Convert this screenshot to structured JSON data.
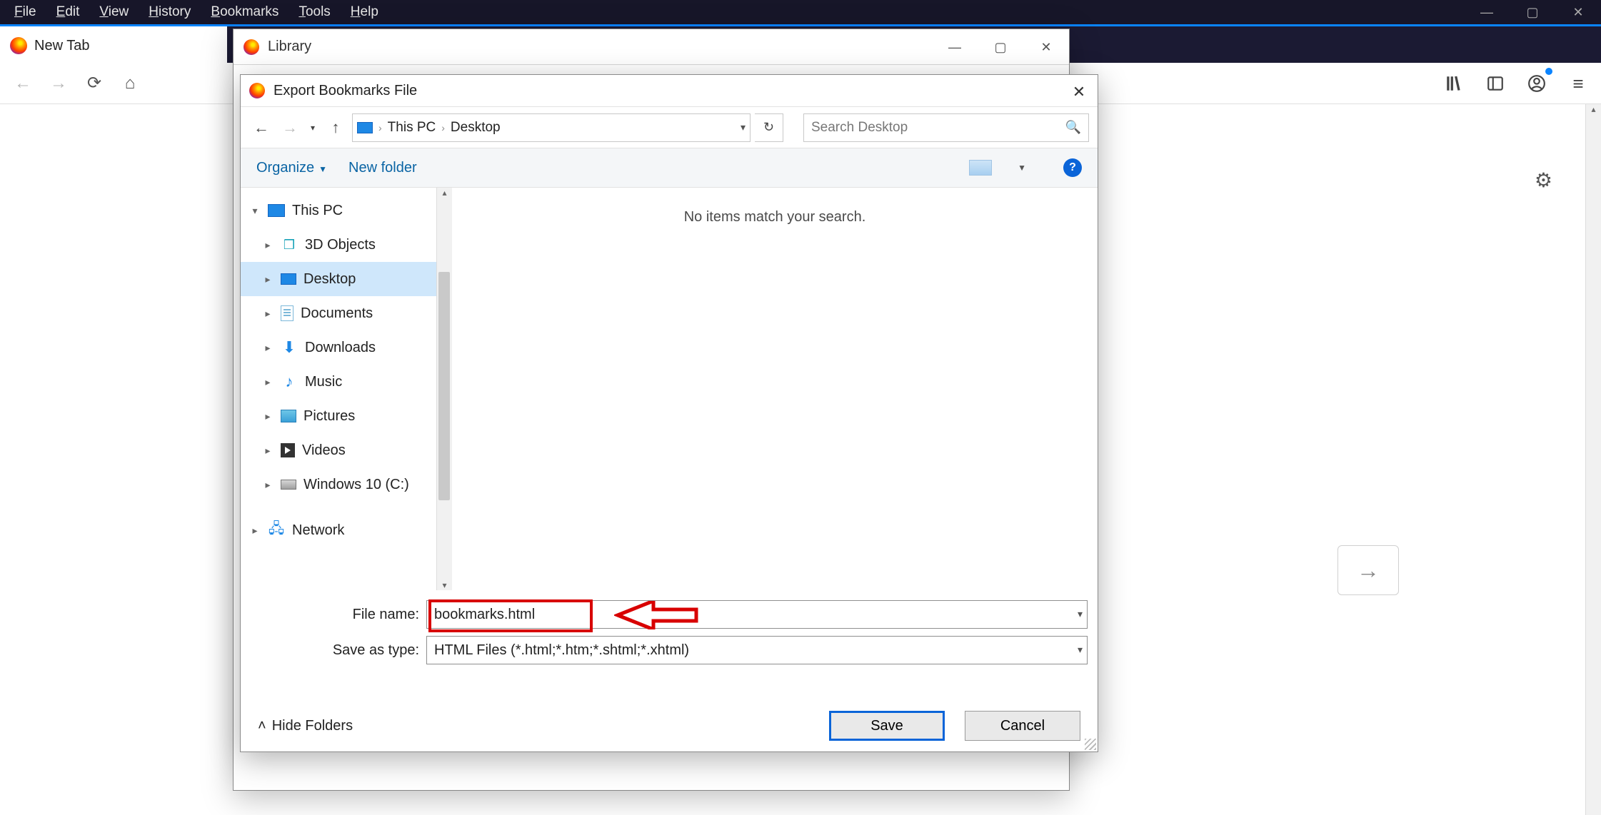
{
  "firefox": {
    "menu": [
      "File",
      "Edit",
      "View",
      "History",
      "Bookmarks",
      "Tools",
      "Help"
    ],
    "tab_label": "New Tab"
  },
  "library": {
    "title": "Library"
  },
  "export": {
    "title": "Export Bookmarks File",
    "breadcrumb": {
      "root": "This PC",
      "leaf": "Desktop"
    },
    "search_placeholder": "Search Desktop",
    "organize": "Organize",
    "new_folder": "New folder",
    "empty_msg": "No items match your search.",
    "tree": {
      "this_pc": "This PC",
      "objects3d": "3D Objects",
      "desktop": "Desktop",
      "documents": "Documents",
      "downloads": "Downloads",
      "music": "Music",
      "pictures": "Pictures",
      "videos": "Videos",
      "cdrive": "Windows 10 (C:)",
      "network": "Network"
    },
    "file_name_label": "File name:",
    "file_name_value": "bookmarks.html",
    "save_type_label": "Save as type:",
    "save_type_value": "HTML Files (*.html;*.htm;*.shtml;*.xhtml)",
    "hide_folders": "Hide Folders",
    "save": "Save",
    "cancel": "Cancel"
  }
}
